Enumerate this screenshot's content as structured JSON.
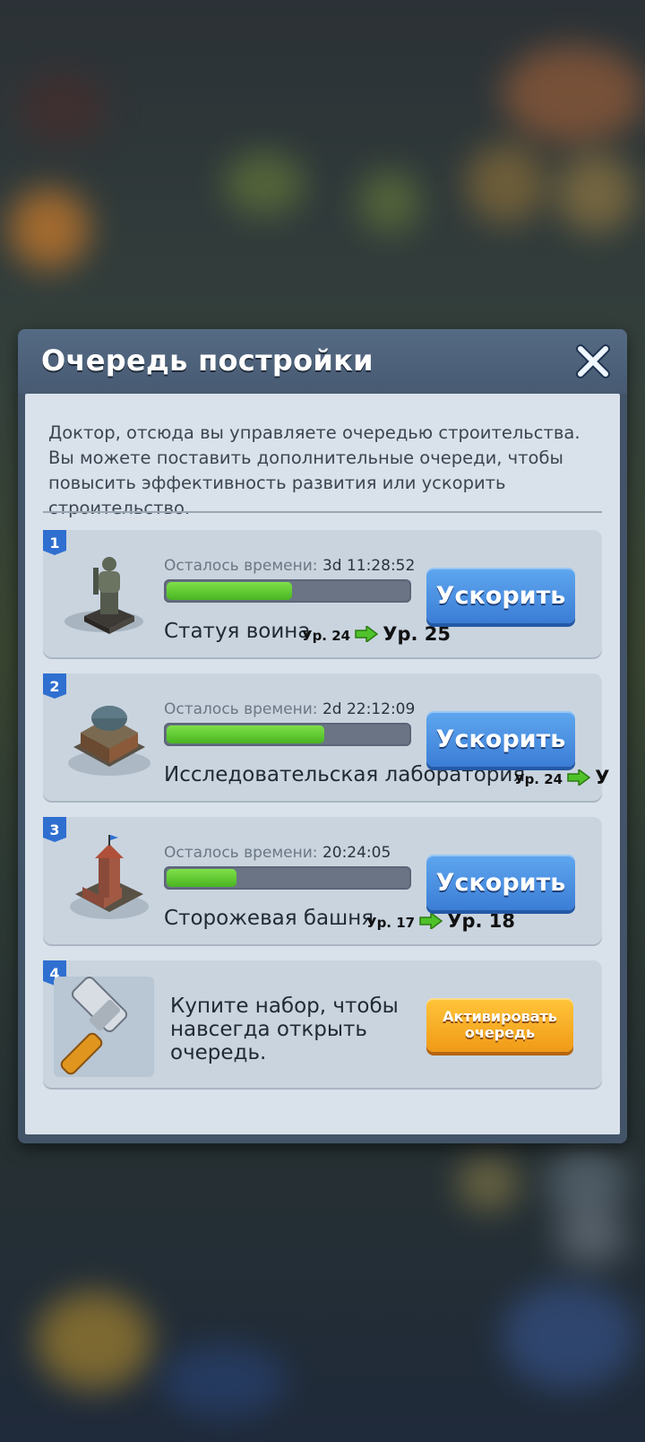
{
  "dialog": {
    "title": "Очередь постройки",
    "description": "Доктор, отсюда вы управляете очередью строительства. Вы можете поставить дополнительные очереди, чтобы повысить эффективность развития или ускорить строительство."
  },
  "queue": [
    {
      "number": "1",
      "time_label": "Осталось времени:",
      "time_value": "3d 11:28:52",
      "progress": 0.52,
      "name": "Статуя воина",
      "level_from": "Ур. 24",
      "level_to": "Ур. 25",
      "button": "Ускорить",
      "icon": "warrior-statue-icon"
    },
    {
      "number": "2",
      "time_label": "Осталось времени:",
      "time_value": "2d 22:12:09",
      "progress": 0.65,
      "name": "Исследовательская лаборатория",
      "level_from": "Ур. 24",
      "level_to": "У",
      "button": "Ускорить",
      "icon": "research-lab-icon"
    },
    {
      "number": "3",
      "time_label": "Осталось времени:",
      "time_value": "20:24:05",
      "progress": 0.29,
      "name": "Сторожевая башня",
      "level_from": "Ур. 17",
      "level_to": "Ур. 18",
      "button": "Ускорить",
      "icon": "watchtower-icon"
    }
  ],
  "locked_slot": {
    "number": "4",
    "text": "Купите набор, чтобы навсегда открыть очередь.",
    "button": "Активировать очередь",
    "icon": "hammer-icon"
  },
  "colors": {
    "accent_blue": "#3b7dd6",
    "progress_green": "#49b521",
    "gold": "#f09a17"
  }
}
